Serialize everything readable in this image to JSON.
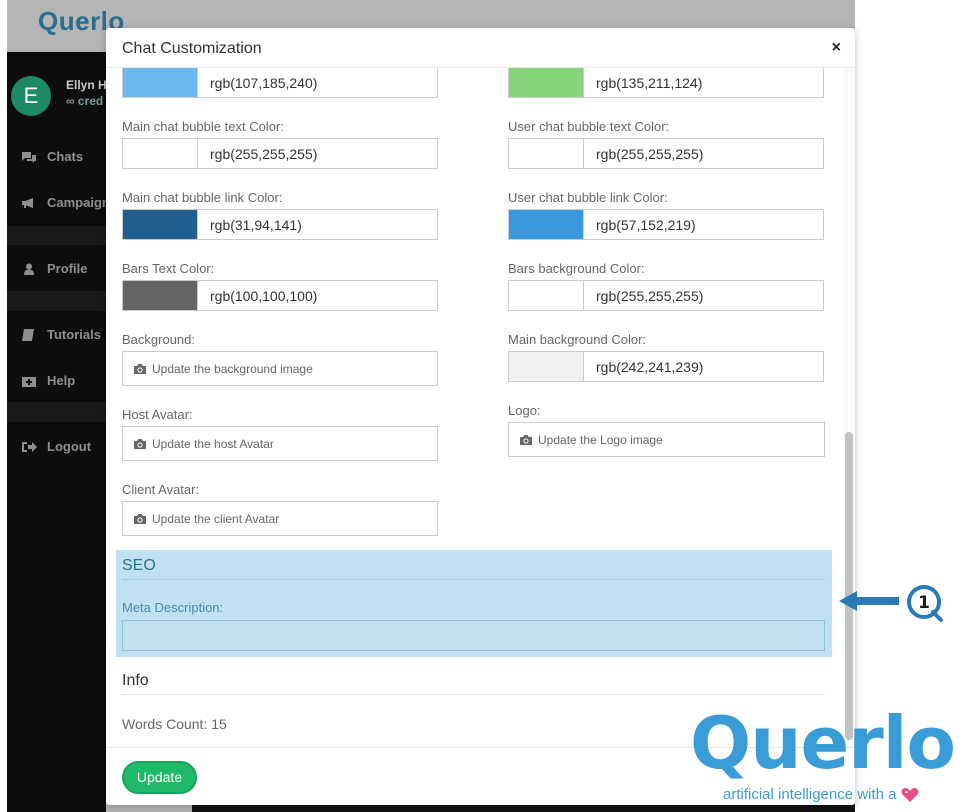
{
  "app": {
    "logo_text": "Querlo",
    "user": {
      "initial": "E",
      "name": "Ellyn H",
      "sub": "∞ cred"
    },
    "nav": [
      {
        "label": "Chats",
        "icon": "chat-icon"
      },
      {
        "label": "Campaign",
        "icon": "bullhorn-icon"
      },
      {
        "label": "Profile",
        "icon": "user-icon"
      },
      {
        "label": "Tutorials",
        "icon": "book-icon"
      },
      {
        "label": "Help",
        "icon": "medkit-icon"
      },
      {
        "label": "Logout",
        "icon": "logout-icon"
      }
    ]
  },
  "modal": {
    "title": "Chat Customization",
    "close_icon": "×"
  },
  "colors_left": [
    {
      "label": "",
      "value": "rgb(107,185,240)",
      "swatch": "#6bb9f0"
    },
    {
      "label": "Main chat bubble text Color:",
      "value": "rgb(255,255,255)",
      "swatch": "#ffffff"
    },
    {
      "label": "Main chat bubble link Color:",
      "value": "rgb(31,94,141)",
      "swatch": "#1f5e8d"
    },
    {
      "label": "Bars Text Color:",
      "value": "rgb(100,100,100)",
      "swatch": "#646464"
    }
  ],
  "colors_right": [
    {
      "label": "",
      "value": "rgb(135,211,124)",
      "swatch": "#87d37c"
    },
    {
      "label": "User chat bubble text Color:",
      "value": "rgb(255,255,255)",
      "swatch": "#ffffff"
    },
    {
      "label": "User chat bubble link Color:",
      "value": "rgb(57,152,219)",
      "swatch": "#3998db"
    },
    {
      "label": "Bars background Color:",
      "value": "rgb(255,255,255)",
      "swatch": "#ffffff"
    },
    {
      "label": "Main background Color:",
      "value": "rgb(242,241,239)",
      "swatch": "#f2f1ef"
    }
  ],
  "uploads": {
    "background": {
      "label": "Background:",
      "button": "Update the background image"
    },
    "host_avatar": {
      "label": "Host Avatar:",
      "button": "Update the host Avatar"
    },
    "client_avatar": {
      "label": "Client Avatar:",
      "button": "Update the client Avatar"
    },
    "logo": {
      "label": "Logo:",
      "button": "Update the Logo image"
    }
  },
  "seo": {
    "title": "SEO",
    "meta_label": "Meta Description:",
    "meta_value": ""
  },
  "info": {
    "title": "Info",
    "words_count": "Words Count: 15"
  },
  "footer": {
    "update_label": "Update"
  },
  "callout": {
    "number": "1"
  },
  "brand": {
    "word": "Querlo",
    "tagline": "artificial intelligence with a",
    "accent": "#3a9cd6"
  }
}
